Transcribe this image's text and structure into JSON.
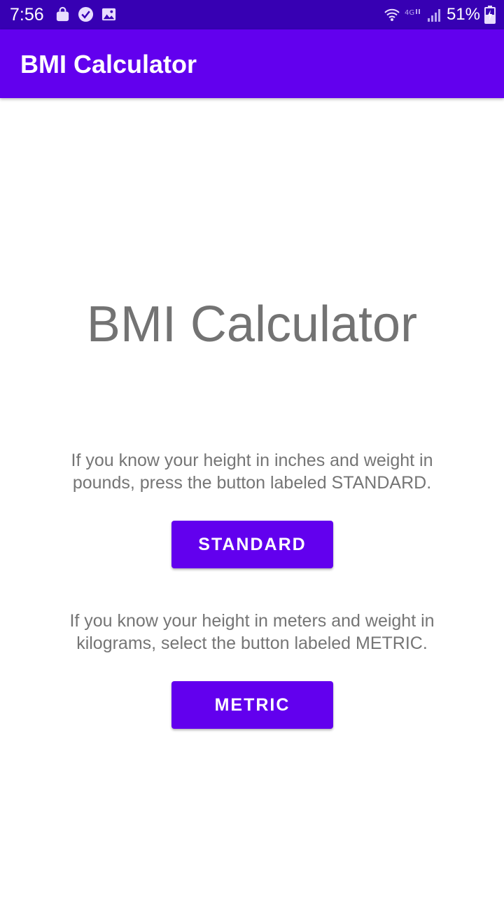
{
  "status_bar": {
    "time": "7:56",
    "battery_percent": "51%",
    "icons": [
      "shopping-bag-icon",
      "check-circle-icon",
      "image-icon",
      "wifi-icon",
      "lte-icon",
      "signal-icon",
      "battery-charging-icon"
    ],
    "background_color": "#3700b3"
  },
  "app_bar": {
    "title": "BMI Calculator",
    "background_color": "#6200ee"
  },
  "main": {
    "title": "BMI Calculator",
    "standard_instruction": "If you know your height in inches and weight in pounds, press the button labeled STANDARD.",
    "standard_button_label": "STANDARD",
    "metric_instruction": "If you know your height in meters and weight in kilograms, select the button labeled METRIC.",
    "metric_button_label": "METRIC",
    "button_color": "#6200ee"
  }
}
